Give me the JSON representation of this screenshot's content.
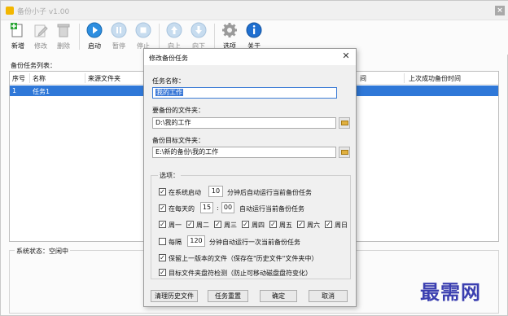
{
  "app": {
    "title": "备份小子 v1.00"
  },
  "toolbar": {
    "new_label": "新增",
    "edit_label": "修改",
    "delete_label": "删除",
    "start_label": "启动",
    "pause_label": "暂停",
    "stop_label": "停止",
    "up_label": "向上",
    "down_label": "向下",
    "options_label": "选项",
    "about_label": "关于"
  },
  "task_list": {
    "caption": "备份任务列表：",
    "columns": [
      "序号",
      "名称",
      "来源文件夹",
      "间",
      "上次成功备份时间"
    ],
    "rows": [
      {
        "index": "1",
        "name": "任务1"
      }
    ]
  },
  "status": {
    "label": "系统状态：空闲中"
  },
  "watermark": {
    "text": "最需网"
  },
  "dialog": {
    "title": "修改备份任务",
    "task_name_label": "任务名称：",
    "task_name_value": "我的工作",
    "source_label": "要备份的文件夹：",
    "source_value": "D:\\我的工作",
    "target_label": "备份目标文件夹：",
    "target_value": "E:\\新的备份\\我的工作",
    "options_label": "选项：",
    "opt_startup_prefix": "在系统启动",
    "opt_startup_minutes": "10",
    "opt_startup_suffix": "分钟后自动运行当前备份任务",
    "opt_daily_prefix": "在每天的",
    "opt_daily_hour": "15",
    "opt_daily_sep": ":",
    "opt_daily_minute": "00",
    "opt_daily_suffix": "自动运行当前备份任务",
    "weekdays": [
      "周一",
      "周二",
      "周三",
      "周四",
      "周五",
      "周六",
      "周日"
    ],
    "opt_every_prefix": "每隔",
    "opt_every_value": "120",
    "opt_every_suffix": "分钟自动运行一次当前备份任务",
    "opt_keep_version": "保留上一版本的文件（保存在\"历史文件\"文件夹中）",
    "opt_check_drive": "目标文件夹盘符检测（防止可移动磁盘盘符变化）",
    "btn_clear_history": "清理历史文件",
    "btn_reset_task": "任务重置",
    "btn_ok": "确定",
    "btn_cancel": "取消"
  },
  "colors": {
    "selection": "#2f78d8",
    "accent": "#3a7bd5",
    "watermark": "#3b3fb0"
  }
}
